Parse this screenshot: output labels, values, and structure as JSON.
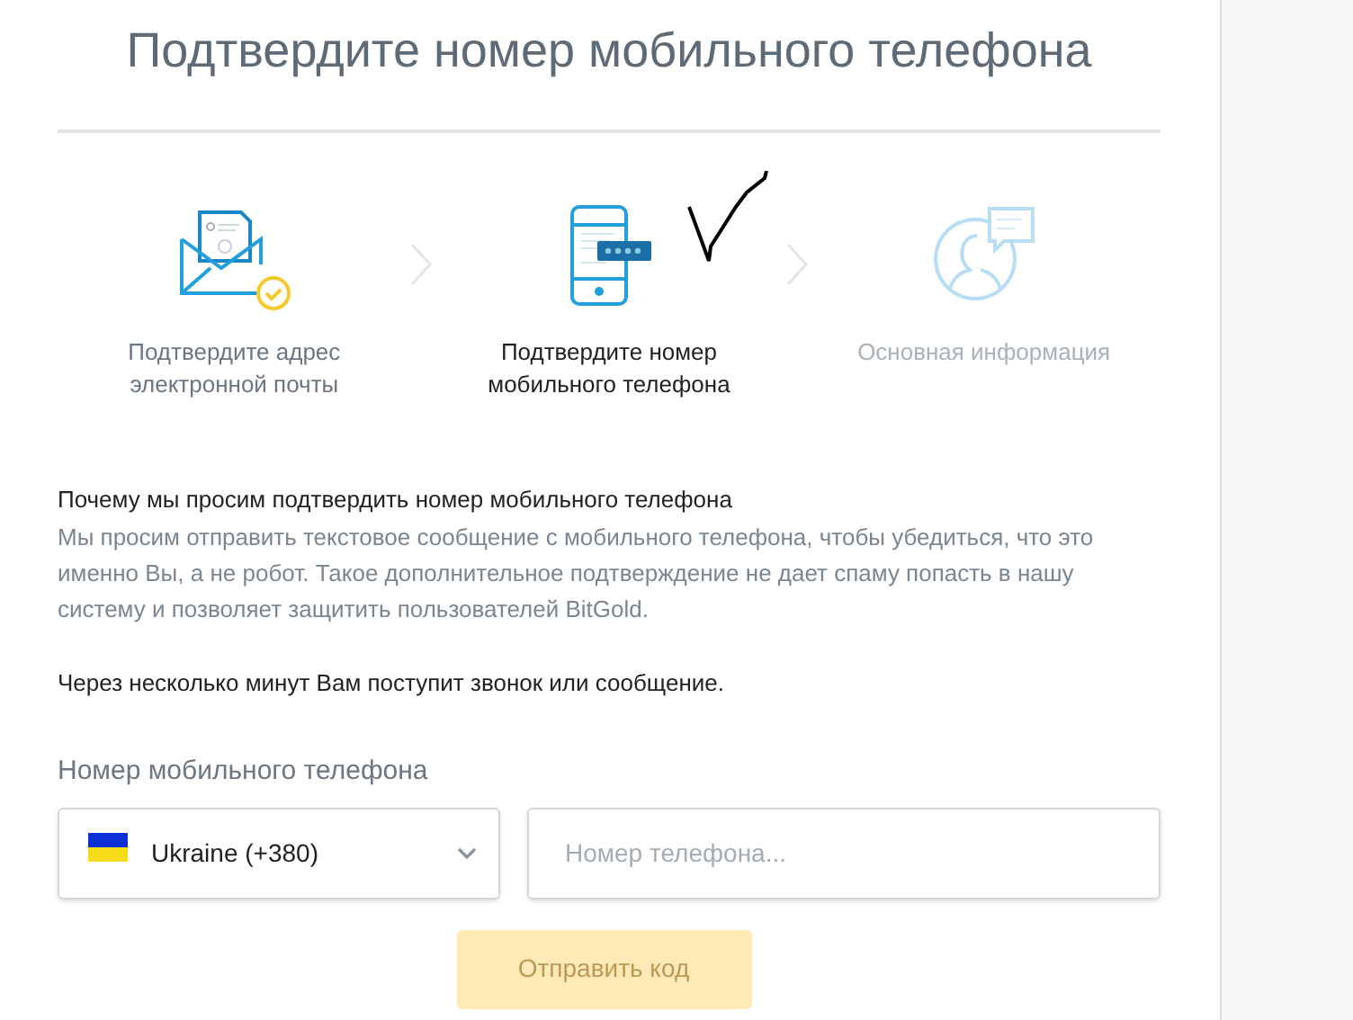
{
  "title": "Подтвердите номер мобильного телефона",
  "steps": [
    {
      "label": "Подтвердите адрес электронной почты",
      "selected": false,
      "done": true,
      "kind": "email"
    },
    {
      "label": "Подтвердите номер мобильного телефона",
      "selected": true,
      "done": false,
      "kind": "phone"
    },
    {
      "label": "Основная информация",
      "selected": false,
      "done": false,
      "kind": "profile"
    }
  ],
  "info": {
    "heading": "Почему мы просим подтвердить номер мобильного телефона",
    "body": "Мы просим отправить текстовое сообщение с мобильного телефона, чтобы убедиться, что это именно Вы, а не робот. Такое дополнительное подтверждение не дает спаму попасть в нашу систему и позволяет защитить пользователей BitGold.",
    "note": "Через несколько минут Вам поступит звонок или сообщение."
  },
  "phone_form": {
    "label": "Номер мобильного телефона",
    "country": "Ukraine (+380)",
    "phone": {
      "placeholder": "Номер телефона..."
    },
    "submit": {
      "label": "Отправить код",
      "disabled": true
    }
  }
}
